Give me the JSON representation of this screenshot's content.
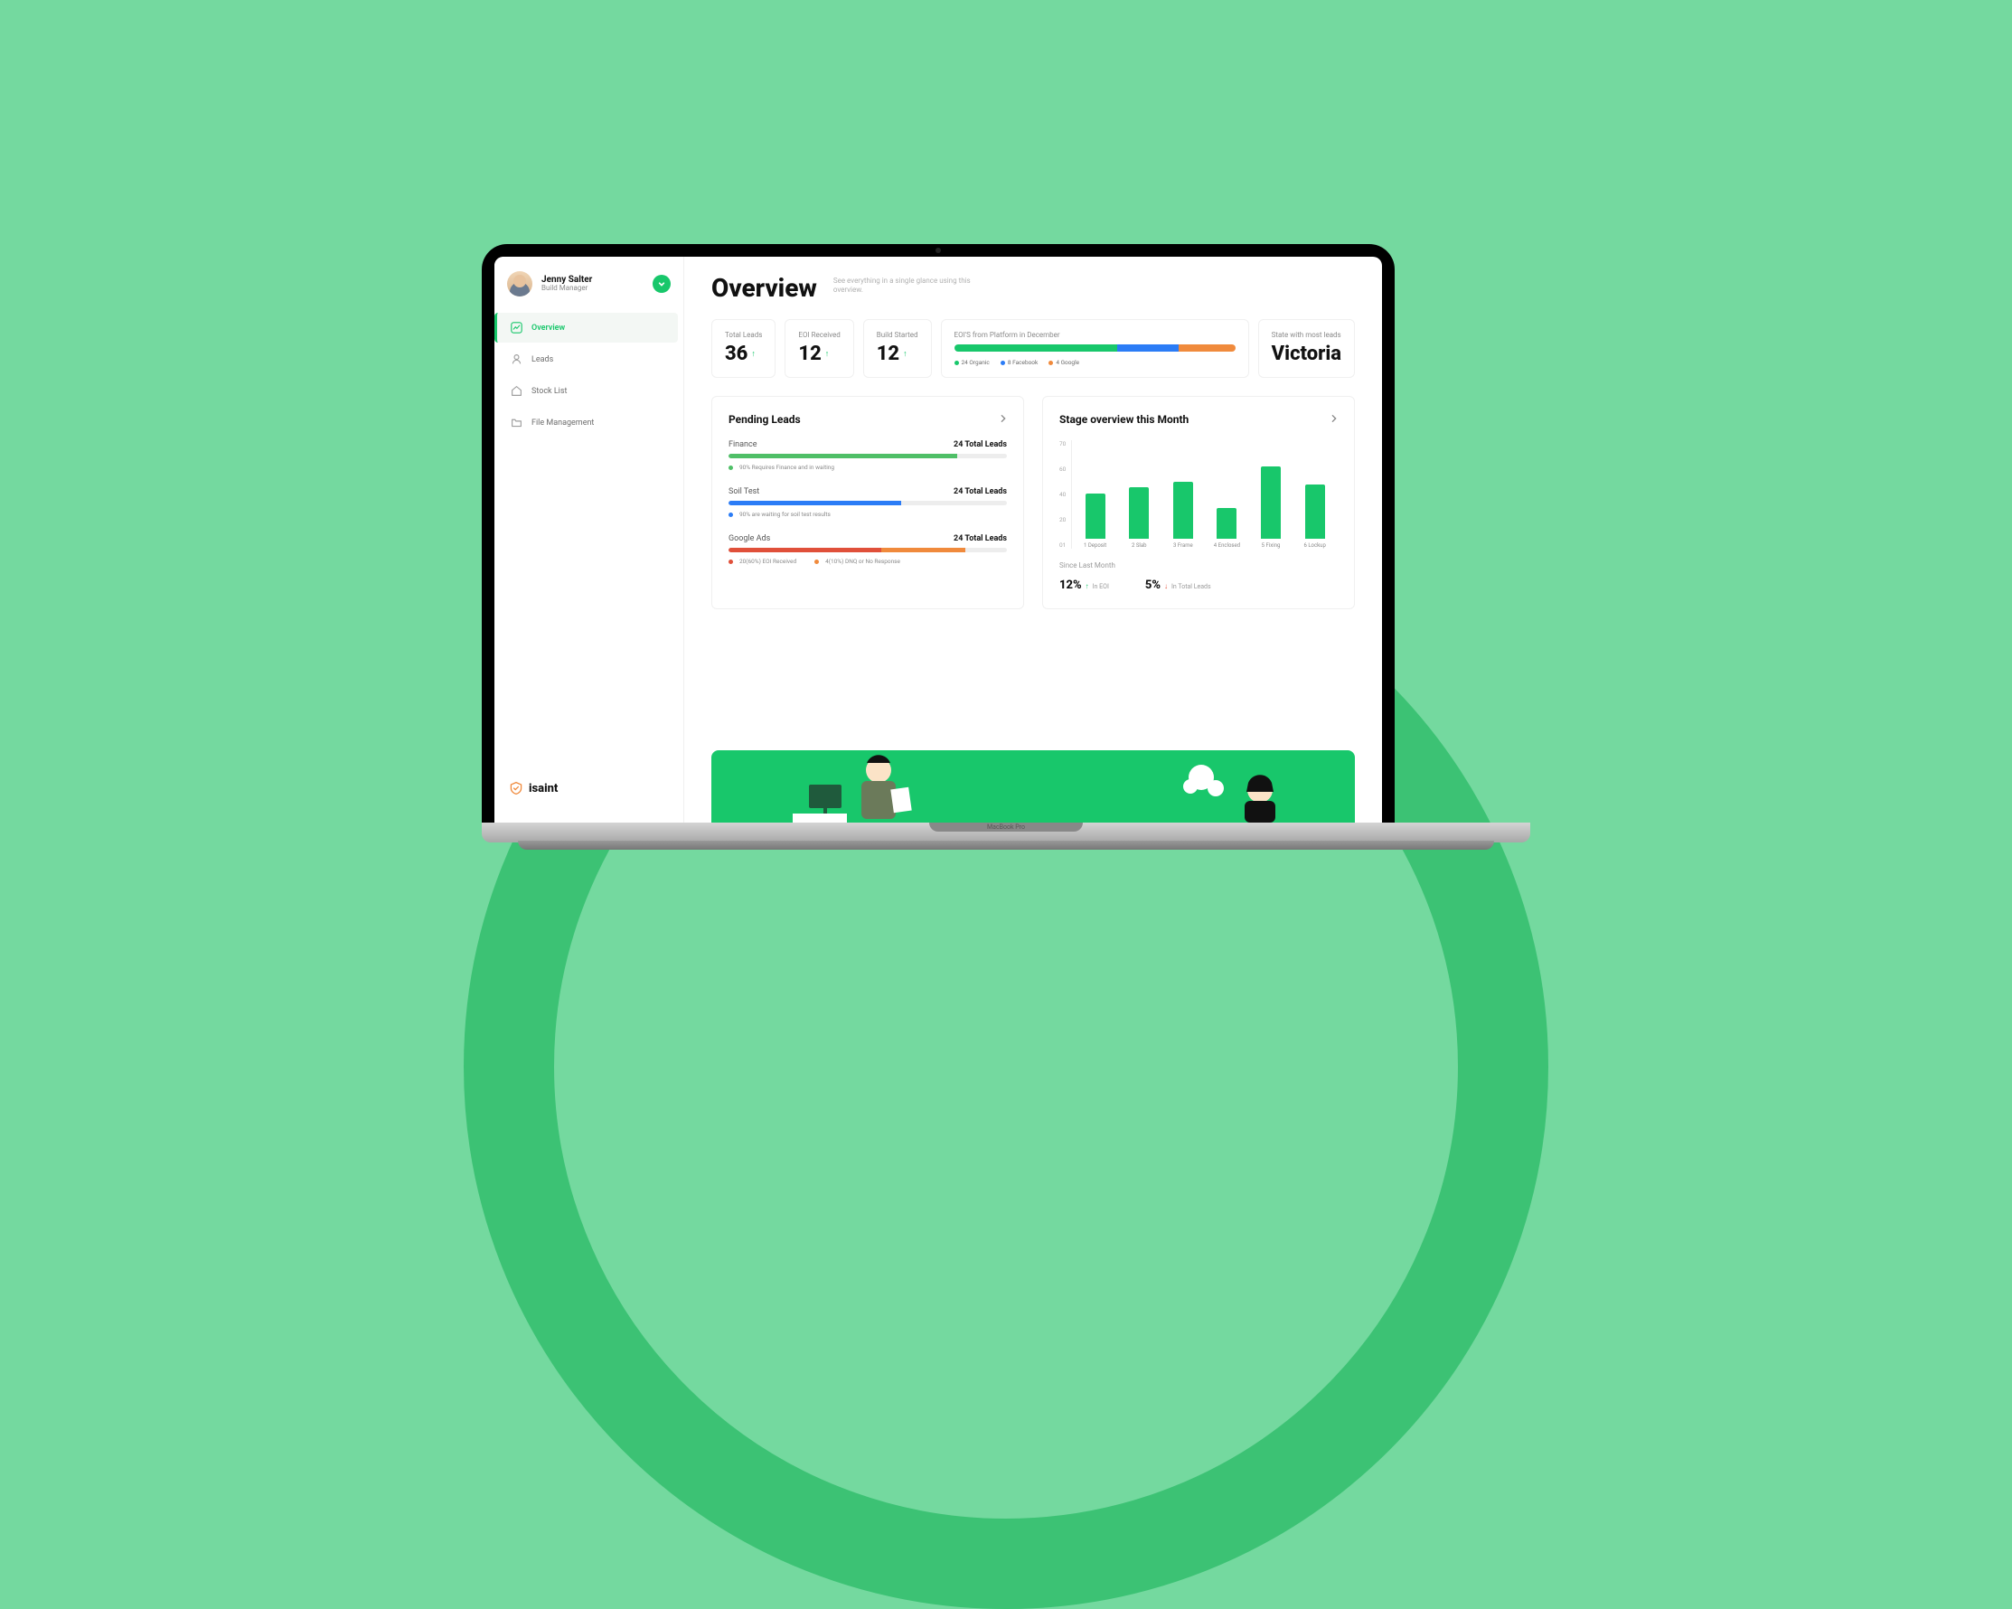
{
  "user": {
    "name": "Jenny Salter",
    "role": "Build Manager"
  },
  "nav": {
    "items": [
      {
        "label": "Overview",
        "icon": "trend-icon",
        "active": true
      },
      {
        "label": "Leads",
        "icon": "person-icon",
        "active": false
      },
      {
        "label": "Stock List",
        "icon": "house-icon",
        "active": false
      },
      {
        "label": "File Management",
        "icon": "folder-icon",
        "active": false
      }
    ]
  },
  "brand": "isaint",
  "header": {
    "title": "Overview",
    "subtitle": "See everything in a single glance using this overview."
  },
  "kpis": [
    {
      "label": "Total Leads",
      "value": "36",
      "trend": "up"
    },
    {
      "label": "EOI Received",
      "value": "12",
      "trend": "up"
    },
    {
      "label": "Build Started",
      "value": "12",
      "trend": "up"
    }
  ],
  "eoi": {
    "title": "EOI'S from Platform in December",
    "segments": [
      {
        "label": "24 Organic",
        "color": "#18c76b",
        "pct": 58
      },
      {
        "label": "8 Facebook",
        "color": "#2b7cf6",
        "pct": 22
      },
      {
        "label": "4 Google",
        "color": "#f08a3c",
        "pct": 20
      }
    ]
  },
  "state": {
    "label": "State with most leads",
    "value": "Victoria"
  },
  "pending": {
    "title": "Pending Leads",
    "items": [
      {
        "category": "Finance",
        "count_label": "24 Total Leads",
        "bars": [
          {
            "color": "#4fbf67",
            "pct": 82
          }
        ],
        "notes": [
          {
            "dot": "#4fbf67",
            "text": "90% Requires Finance and in waiting"
          }
        ]
      },
      {
        "category": "Soil Test",
        "count_label": "24 Total Leads",
        "bars": [
          {
            "color": "#2b7cf6",
            "pct": 62
          }
        ],
        "notes": [
          {
            "dot": "#2b7cf6",
            "text": "90% are waiting for soil test results"
          }
        ]
      },
      {
        "category": "Google Ads",
        "count_label": "24 Total Leads",
        "bars": [
          {
            "color": "#e0503a",
            "pct": 55
          },
          {
            "color": "#f08a3c",
            "pct": 30
          }
        ],
        "notes": [
          {
            "dot": "#e0503a",
            "text": "20(60%) EOI Received"
          },
          {
            "dot": "#f08a3c",
            "text": "4(10%) DNQ or No Response"
          }
        ]
      }
    ]
  },
  "stage": {
    "title": "Stage overview this Month",
    "since_label": "Since Last Month",
    "deltas": [
      {
        "value": "12%",
        "dir": "up",
        "label": "In EOI"
      },
      {
        "value": "5%",
        "dir": "down",
        "label": "In Total Leads"
      }
    ]
  },
  "chart_data": {
    "type": "bar",
    "title": "Stage overview this Month",
    "categories": [
      "1 Deposit",
      "2 Slab",
      "3 Frame",
      "4 Enclosed",
      "5 Fixing",
      "6 Lockup"
    ],
    "values": [
      35,
      40,
      44,
      24,
      56,
      42
    ],
    "ylabel": "",
    "y_ticks": [
      70,
      60,
      40,
      20,
      "01"
    ],
    "ylim": [
      0,
      70
    ]
  },
  "laptop_label": "MacBook Pro"
}
